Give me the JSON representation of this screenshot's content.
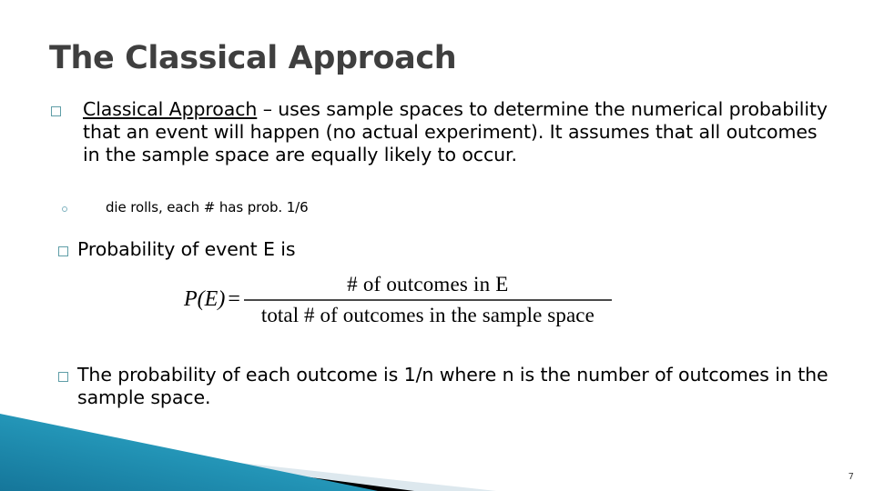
{
  "slide": {
    "title": "The Classical Approach",
    "page_number": "7",
    "background_color": "#ffffff",
    "title_color": "#3f3f3f"
  },
  "body": {
    "bullet_1": {
      "marker": "hollow-square",
      "lead_underlined": "Classical Approach",
      "rest": " – uses sample spaces to determine the numerical  probability that an event will happen (no actual experiment).  It assumes that all outcomes in the sample space are equally likely to occur."
    },
    "bullet_1_sub": {
      "marker": "hollow-circle",
      "text": "die rolls, each # has prob. 1/6"
    },
    "bullet_2": {
      "marker": "hollow-square",
      "text": "Probability of event E is"
    },
    "bullet_3": {
      "marker": "hollow-square",
      "text": "The probability of each outcome is 1/n where n is the number of outcomes in the sample space."
    }
  },
  "formula": {
    "lhs": "P(E)",
    "equals": "=",
    "numerator": "# of outcomes in E",
    "denominator": "total # of outcomes in the sample space"
  },
  "decoration": {
    "teal_dark": "#15769a",
    "teal_mid": "#2293b5",
    "teal_light": "#45b4d2",
    "black_band": "#000000",
    "pale_band": "#dde8ee"
  }
}
